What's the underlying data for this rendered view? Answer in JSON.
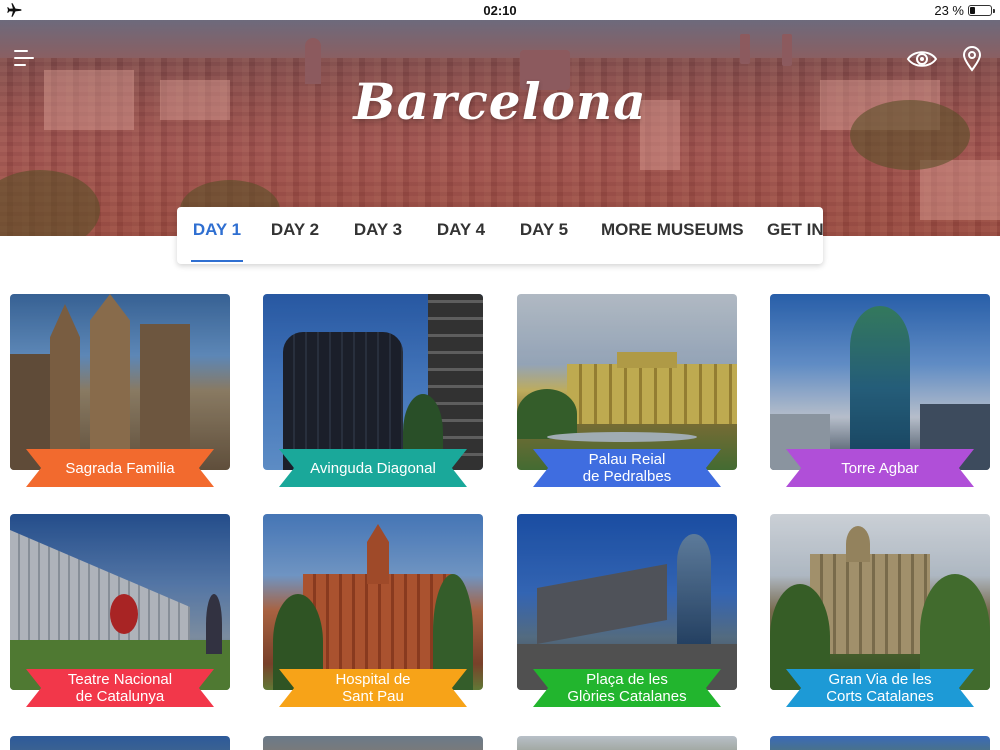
{
  "status_bar": {
    "time": "02:10",
    "battery_percent": "23 %",
    "battery_level": 0.23,
    "airplane_icon": "airplane-icon"
  },
  "header": {
    "title": "Barcelona",
    "menu_icon": "menu-icon",
    "eye_icon": "eye-icon",
    "location_icon": "map-pin-icon"
  },
  "tabs": [
    {
      "label": "DAY 1",
      "active": true
    },
    {
      "label": "DAY 2",
      "active": false
    },
    {
      "label": "DAY 3",
      "active": false
    },
    {
      "label": "DAY 4",
      "active": false
    },
    {
      "label": "DAY 5",
      "active": false
    },
    {
      "label": "MORE MUSEUMS",
      "active": false
    },
    {
      "label": "GET IN",
      "active": false
    }
  ],
  "cards": [
    {
      "label": "Sagrada Familia",
      "color": "#f26a2e"
    },
    {
      "label": "Avinguda Diagonal",
      "color": "#1aa89a"
    },
    {
      "label": "Palau Reial\nde Pedralbes",
      "color": "#3f6de0"
    },
    {
      "label": "Torre Agbar",
      "color": "#b04fd8"
    },
    {
      "label": "Teatre Nacional\nde Catalunya",
      "color": "#f2374a"
    },
    {
      "label": "Hospital de\nSant Pau",
      "color": "#f7a318"
    },
    {
      "label": "Plaça de les\nGlòries Catalanes",
      "color": "#22b52e"
    },
    {
      "label": "Gran Via de les\nCorts Catalanes",
      "color": "#1d9ad6"
    }
  ],
  "colors": {
    "accent": "#2f6fd1",
    "tab_text": "#333333"
  }
}
